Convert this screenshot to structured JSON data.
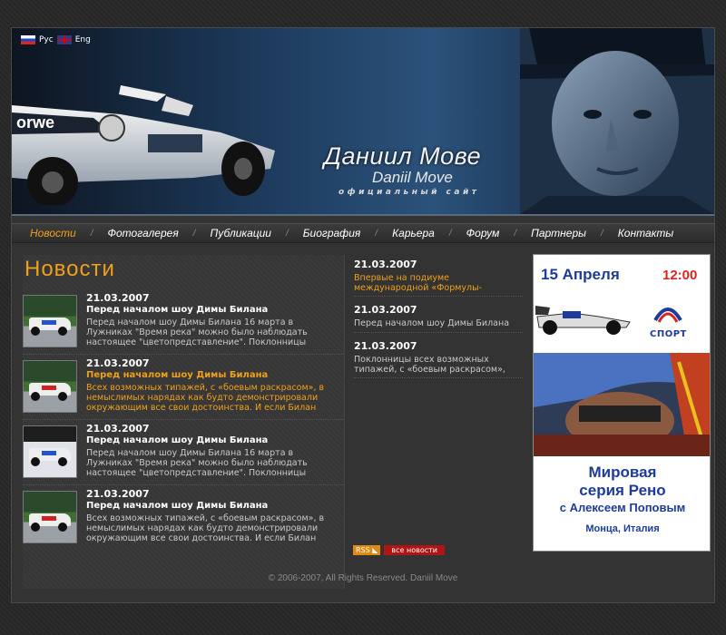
{
  "lang": {
    "ru": "Рус",
    "en": "Eng"
  },
  "header": {
    "name_ru": "Даниил Мове",
    "name_en": "Daniil Move",
    "subtitle": "официальный сайт"
  },
  "nav": [
    {
      "label": "Новости",
      "active": true
    },
    {
      "label": "Фотогалерея"
    },
    {
      "label": "Публикации"
    },
    {
      "label": "Биография"
    },
    {
      "label": "Карьера"
    },
    {
      "label": "Форум"
    },
    {
      "label": "Партнеры"
    },
    {
      "label": "Контакты"
    }
  ],
  "news": {
    "title": "Новости",
    "items": [
      {
        "date": "21.03.2007",
        "headline": "Перед началом шоу Димы Билана",
        "text": "Перед началом шоу Димы Билана 16 марта в Лужниках \"Время река\" можно было наблюдать настоящее \"цветопредставление\". Поклонницы"
      },
      {
        "date": "21.03.2007",
        "headline": "Перед началом шоу Димы Билана",
        "text": "Всех возможных типажей, с «боевым раскрасом», в немыслимых нарядах как будто демонстрировали окружающим все свои достоинства. И если Билан"
      },
      {
        "date": "21.03.2007",
        "headline": "Перед началом шоу Димы Билана",
        "text": "Перед началом шоу Димы Билана 16 марта в Лужниках \"Время река\" можно было наблюдать настоящее \"цветопредставление\". Поклонницы"
      },
      {
        "date": "21.03.2007",
        "headline": "Перед началом шоу Димы Билана",
        "text": "Всех возможных типажей, с «боевым раскрасом», в немыслимых нарядах как будто демонстрировали окружающим все свои достоинства. И если Билан"
      }
    ]
  },
  "mid": {
    "items": [
      {
        "date": "21.03.2007",
        "text": "Впервые на подиуме международной «Формулы-"
      },
      {
        "date": "21.03.2007",
        "text": "Перед началом шоу Димы Билана"
      },
      {
        "date": "21.03.2007",
        "text": "Поклонницы всех возможных типажей, с «боевым раскрасом»,"
      }
    ],
    "rss": "RSS",
    "all_news": "все новости"
  },
  "banner": {
    "date": "15 Апреля",
    "time": "12:00",
    "channel": "СПОРТ",
    "line1": "Мировая",
    "line2": "серия Рено",
    "line3": "с Алексеем Поповым",
    "line4": "Монца, Италия"
  },
  "footer": "© 2006-2007, All Rights Reserved. Daniil Move",
  "colors": {
    "accent": "#f0a018",
    "banner_blue": "#1d3c99",
    "all_news_red": "#b01515"
  }
}
